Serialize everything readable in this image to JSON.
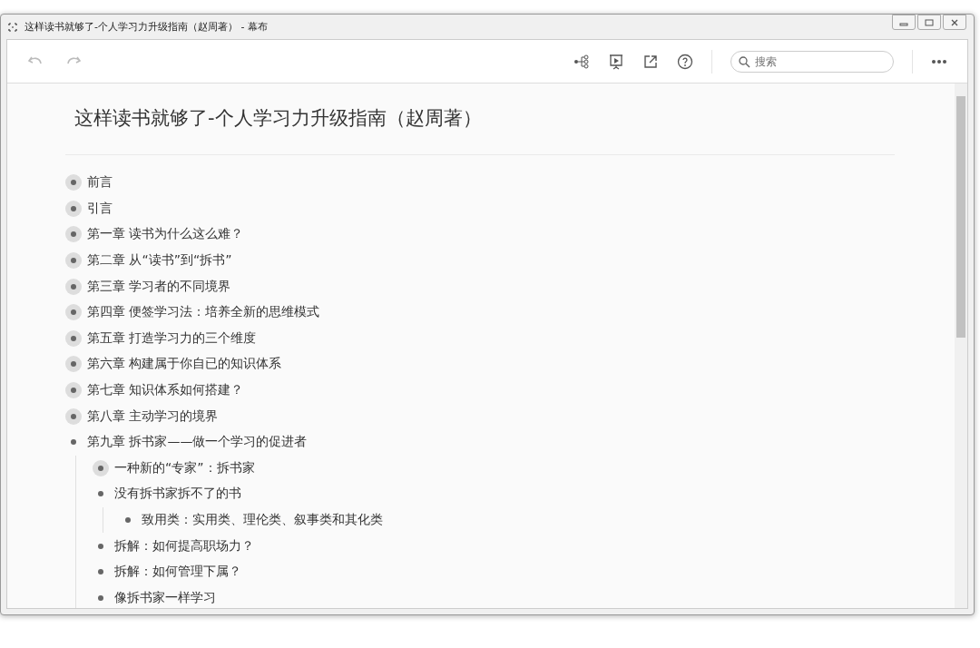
{
  "window": {
    "title": "这样读书就够了-个人学习力升级指南（赵周著） - 幕布"
  },
  "search": {
    "placeholder": "搜索"
  },
  "document": {
    "title": "这样读书就够了-个人学习力升级指南（赵周著）",
    "outline": [
      {
        "text": "前言",
        "collapsed": true
      },
      {
        "text": "引言",
        "collapsed": true
      },
      {
        "text": "第一章 读书为什么这么难？",
        "collapsed": true
      },
      {
        "text": "第二章 从“读书”到“拆书”",
        "collapsed": true
      },
      {
        "text": "第三章 学习者的不同境界",
        "collapsed": true
      },
      {
        "text": "第四章 便签学习法：培养全新的思维模式",
        "collapsed": true
      },
      {
        "text": "第五章 打造学习力的三个维度",
        "collapsed": true
      },
      {
        "text": "第六章 构建属于你自已的知识体系",
        "collapsed": true
      },
      {
        "text": "第七章 知识体系如何搭建？",
        "collapsed": true
      },
      {
        "text": "第八章 主动学习的境界",
        "collapsed": true
      },
      {
        "text": "第九章 拆书家——做一个学习的促进者",
        "collapsed": false,
        "children": [
          {
            "text": "一种新的“专家”：拆书家",
            "collapsed": true
          },
          {
            "text": "没有拆书家拆不了的书",
            "collapsed": false,
            "children": [
              {
                "text": "致用类：实用类、理伦类、叙事类和其化类",
                "collapsed": false
              }
            ]
          },
          {
            "text": "拆解：如何提高职场力？",
            "collapsed": false
          },
          {
            "text": "拆解：如何管理下属？",
            "collapsed": false
          },
          {
            "text": "像拆书家一样学习",
            "collapsed": false
          }
        ]
      }
    ]
  }
}
